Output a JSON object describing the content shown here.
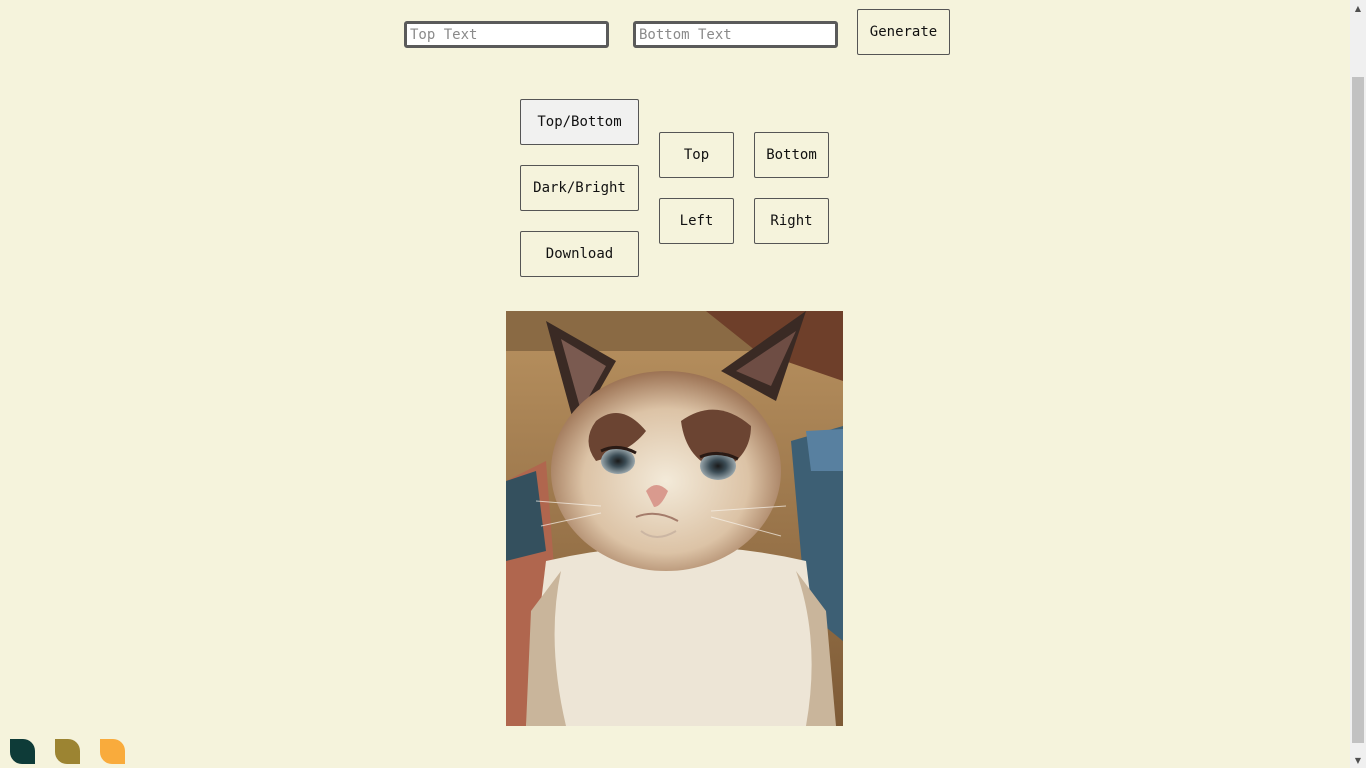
{
  "inputs": {
    "top_placeholder": "Top Text",
    "bottom_placeholder": "Bottom Text",
    "top_value": "",
    "bottom_value": ""
  },
  "buttons": {
    "generate": "Generate",
    "top_bottom": "Top/Bottom",
    "dark_bright": "Dark/Bright",
    "download": "Download",
    "top": "Top",
    "bottom": "Bottom",
    "left": "Left",
    "right": "Right"
  },
  "image": {
    "subject": "grumpy-cat-photo"
  },
  "theme_swatches": [
    {
      "name": "dark-teal",
      "color": "#0e3b38"
    },
    {
      "name": "olive",
      "color": "#9c8432"
    },
    {
      "name": "orange",
      "color": "#f9ab3c"
    }
  ],
  "colors": {
    "background": "#f5f3dc"
  }
}
